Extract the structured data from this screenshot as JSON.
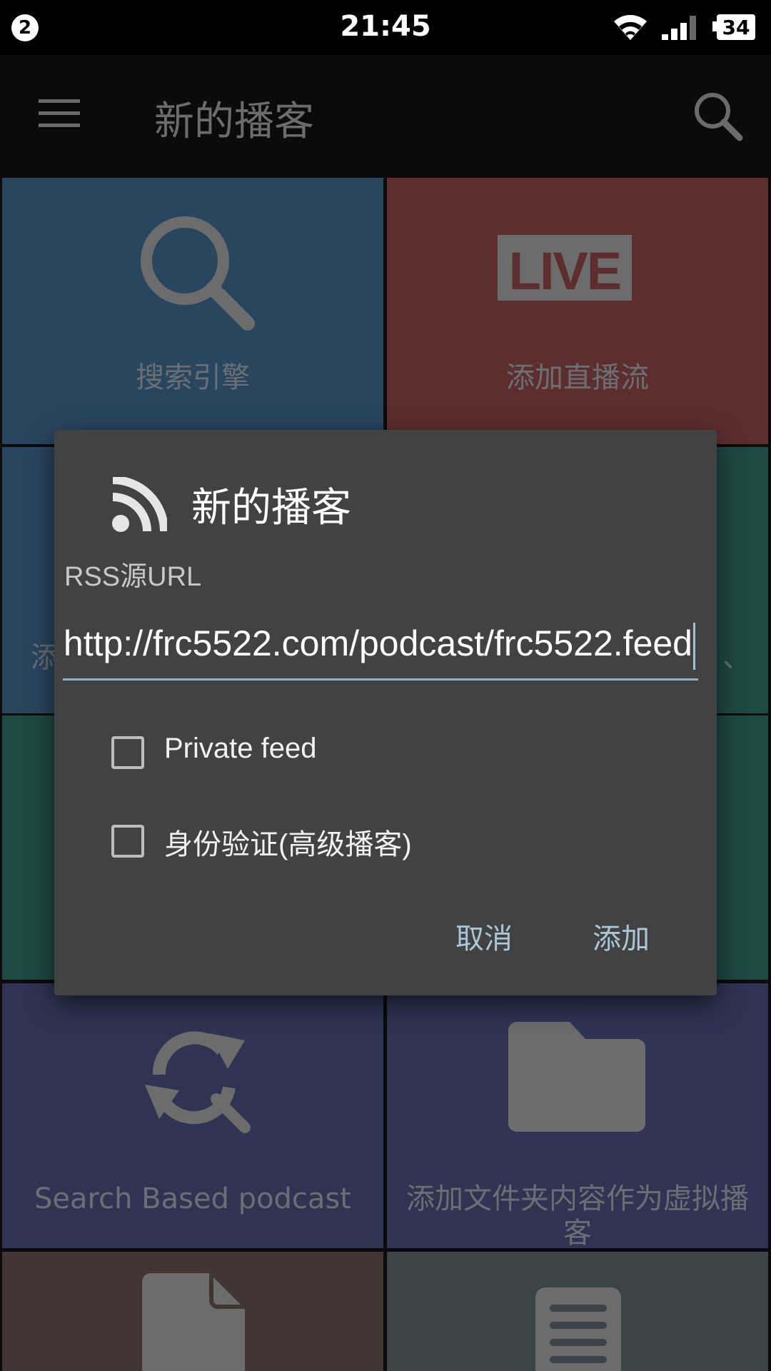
{
  "status_bar": {
    "notification_count": "2",
    "time": "21:45",
    "battery": "34"
  },
  "app_bar": {
    "title": "新的播客"
  },
  "tiles": [
    {
      "label": "搜索引擎",
      "icon": "search-icon",
      "color": "#294660"
    },
    {
      "label": "添加直播流",
      "icon": "live-icon",
      "color": "#5e2e2e",
      "icon_text": "LIVE"
    },
    {
      "label": "添",
      "icon": "",
      "color": "#294660"
    },
    {
      "label": "、",
      "icon": "",
      "color": "#1f4a44"
    },
    {
      "label": "",
      "icon": "",
      "color": "#1f4a44"
    },
    {
      "label": "",
      "icon": "",
      "color": "#1f4a44"
    },
    {
      "label": "Search Based podcast",
      "icon": "sync-search-icon",
      "color": "#2f3453"
    },
    {
      "label": "添加文件夹内容作为虚拟播客",
      "icon": "folder-icon",
      "color": "#2f3453"
    },
    {
      "label": "",
      "icon": "file-icon",
      "color": "#433534"
    },
    {
      "label": "",
      "icon": "document-icon",
      "color": "#3b4547"
    }
  ],
  "dialog": {
    "title": "新的播客",
    "url_label": "RSS源URL",
    "url_value": "http://frc5522.com/podcast/frc5522.feed",
    "private_feed_label": "Private feed",
    "auth_label": "身份验证(高级播客)",
    "cancel_label": "取消",
    "add_label": "添加"
  }
}
